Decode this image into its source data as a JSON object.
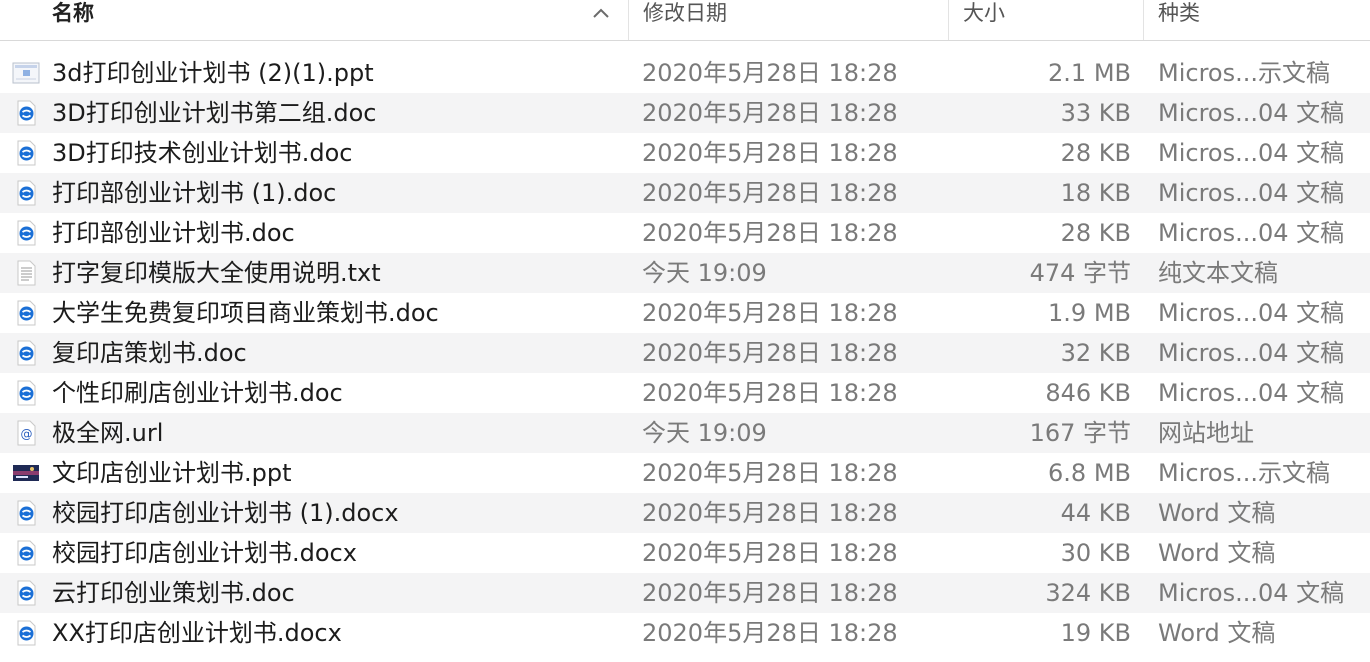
{
  "header": {
    "name_label": "名称",
    "date_label": "修改日期",
    "size_label": "大小",
    "kind_label": "种类",
    "sort_direction": "ascending"
  },
  "colors": {
    "row_alt_bg": "#f4f4f5",
    "doc_icon_blue": "#1a6fd6",
    "secondary_text": "#7a7a7a"
  },
  "files": [
    {
      "name": "3d打印创业计划书 (2)(1).ppt",
      "date": "2020年5月28日 18:28",
      "size": "2.1 MB",
      "kind": "Micros...示文稿",
      "icon": "ppt-thumbnail-icon"
    },
    {
      "name": "3D打印创业计划书第二组.doc",
      "date": "2020年5月28日 18:28",
      "size": "33 KB",
      "kind": "Micros...04 文稿",
      "icon": "doc-icon"
    },
    {
      "name": "3D打印技术创业计划书.doc",
      "date": "2020年5月28日 18:28",
      "size": "28 KB",
      "kind": "Micros...04 文稿",
      "icon": "doc-icon"
    },
    {
      "name": "打印部创业计划书 (1).doc",
      "date": "2020年5月28日 18:28",
      "size": "18 KB",
      "kind": "Micros...04 文稿",
      "icon": "doc-icon"
    },
    {
      "name": "打印部创业计划书.doc",
      "date": "2020年5月28日 18:28",
      "size": "28 KB",
      "kind": "Micros...04 文稿",
      "icon": "doc-icon"
    },
    {
      "name": "打字复印模版大全使用说明.txt",
      "date": "今天 19:09",
      "size": "474 字节",
      "kind": "纯文本文稿",
      "icon": "txt-icon"
    },
    {
      "name": "大学生免费复印项目商业策划书.doc",
      "date": "2020年5月28日 18:28",
      "size": "1.9 MB",
      "kind": "Micros...04 文稿",
      "icon": "doc-icon"
    },
    {
      "name": "复印店策划书.doc",
      "date": "2020年5月28日 18:28",
      "size": "32 KB",
      "kind": "Micros...04 文稿",
      "icon": "doc-icon"
    },
    {
      "name": "个性印刷店创业计划书.doc",
      "date": "2020年5月28日 18:28",
      "size": "846 KB",
      "kind": "Micros...04 文稿",
      "icon": "doc-icon"
    },
    {
      "name": "极全网.url",
      "date": "今天 19:09",
      "size": "167 字节",
      "kind": "网站地址",
      "icon": "url-icon"
    },
    {
      "name": "文印店创业计划书.ppt",
      "date": "2020年5月28日 18:28",
      "size": "6.8 MB",
      "kind": "Micros...示文稿",
      "icon": "ppt-dark-thumbnail-icon"
    },
    {
      "name": "校园打印店创业计划书 (1).docx",
      "date": "2020年5月28日 18:28",
      "size": "44 KB",
      "kind": "Word 文稿",
      "icon": "doc-icon"
    },
    {
      "name": "校园打印店创业计划书.docx",
      "date": "2020年5月28日 18:28",
      "size": "30 KB",
      "kind": "Word 文稿",
      "icon": "doc-icon"
    },
    {
      "name": "云打印创业策划书.doc",
      "date": "2020年5月28日 18:28",
      "size": "324 KB",
      "kind": "Micros...04 文稿",
      "icon": "doc-icon"
    },
    {
      "name": "XX打印店创业计划书.docx",
      "date": "2020年5月28日 18:28",
      "size": "19 KB",
      "kind": "Word 文稿",
      "icon": "doc-icon"
    }
  ]
}
